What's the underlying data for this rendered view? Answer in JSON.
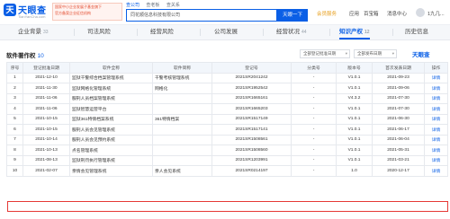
{
  "header": {
    "logo_glyph": "天",
    "logo_text": "天眼查",
    "logo_sub": "TianYanCha.com",
    "gov_line1": "国家中小企业发展子基金旗下",
    "gov_line2": "官方备案企业征信机构",
    "search_tabs": [
      "查公司",
      "查老板",
      "查关系"
    ],
    "search_value": "同花顺信息科技有限公司",
    "search_button": "天眼一下",
    "vip": "会员服务",
    "nav_app": "应用",
    "nav_biz": "百宝箱",
    "nav_msg": "消息中心",
    "user": "1九几..."
  },
  "tabs": [
    {
      "label": "企业背景",
      "count": "33"
    },
    {
      "label": "司法风险",
      "count": ""
    },
    {
      "label": "经营风险",
      "count": ""
    },
    {
      "label": "公司发展",
      "count": ""
    },
    {
      "label": "经营状况",
      "count": "44"
    },
    {
      "label": "知识产权",
      "count": "12"
    },
    {
      "label": "历史信息",
      "count": ""
    }
  ],
  "section": {
    "title": "软件著作权",
    "count": "10",
    "filter1": "全部登记批准日期",
    "filter2": "全部发布日期",
    "brand": "天眼查"
  },
  "table": {
    "headers": [
      "序号",
      "登记批准日期",
      "软件全称",
      "软件简称",
      "登记号",
      "分类号",
      "版本号",
      "首次发表日期",
      "操作"
    ],
    "rows": [
      [
        "1",
        "2021-12-10",
        "监狱干警综合档案管理系统",
        "干警考核管理系统",
        "2021SR2041242",
        "-",
        "V1.0.1",
        "2021-09-23",
        "详情"
      ],
      [
        "2",
        "2021-11-30",
        "监狱网格化管理系统",
        "网格化",
        "2021SR1952542",
        "-",
        "V1.0.1",
        "2021-09-06",
        "详情"
      ],
      [
        "3",
        "2021-11-06",
        "服刑人员档案管理系统",
        "",
        "2021SR1665161",
        "-",
        "V4.3.2",
        "2021-07-30",
        "详情"
      ],
      [
        "4",
        "2021-11-06",
        "监狱智慧运营平台",
        "",
        "2021SR1665203",
        "-",
        "V1.0.1",
        "2021-07-30",
        "详情"
      ],
      [
        "5",
        "2021-10-15",
        "监狱361特情档案系统",
        "361特情档案",
        "2021SR1517149",
        "-",
        "V1.0.1",
        "2021-06-30",
        "详情"
      ],
      [
        "6",
        "2021-10-15",
        "服刑人员会见管理系统",
        "",
        "2021SR1517141",
        "-",
        "V1.0.1",
        "2021-06-17",
        "详情"
      ],
      [
        "7",
        "2021-10-14",
        "服刑人员会见预约系统",
        "",
        "2021SR1508561",
        "-",
        "V1.0.1",
        "2021-06-04",
        "详情"
      ],
      [
        "8",
        "2021-10-13",
        "点名管理系统",
        "",
        "2021SR1508560",
        "-",
        "V1.0.1",
        "2021-05-31",
        "详情"
      ],
      [
        "9",
        "2021-08-13",
        "监狱刑罚执行管理系统",
        "",
        "2021SR1203991",
        "-",
        "V1.0.1",
        "2021-03-21",
        "详情"
      ],
      [
        "10",
        "2021-02-07",
        "亲情会见管理系统",
        "亲人会见系统",
        "2021SR0214197",
        "-",
        "1.0",
        "2020-12-17",
        "详情"
      ]
    ]
  }
}
